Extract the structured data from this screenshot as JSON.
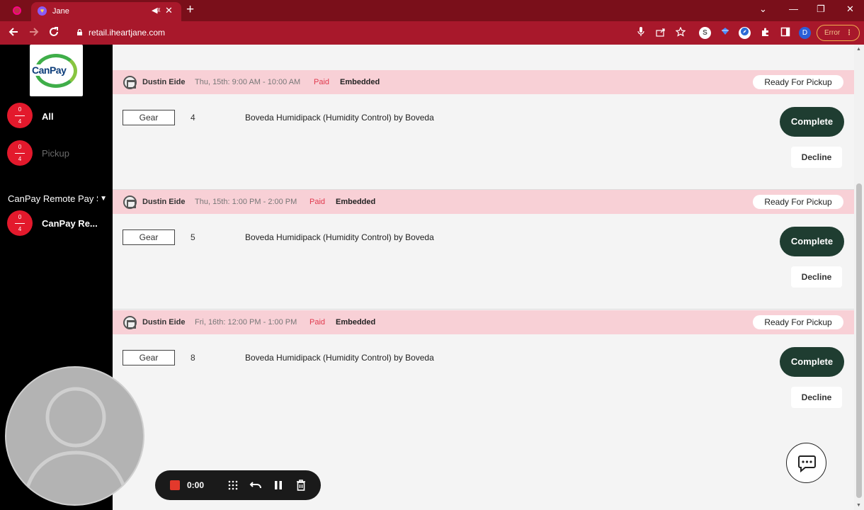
{
  "browser": {
    "tab_title": "Jane",
    "tab_close": "✕",
    "new_tab": "+",
    "url": "retail.iheartjane.com",
    "profile_initial": "D",
    "error_label": "Error",
    "error_menu": "⋮",
    "extension_s_label": "S",
    "window_minimize": "—",
    "window_maximize": "❐",
    "window_close": "✕",
    "tab_search": "⌄"
  },
  "sidebar": {
    "logo_text": "CanPay",
    "items": [
      {
        "label": "All",
        "count_top": "0",
        "count_bottom": "4"
      },
      {
        "label": "Pickup",
        "count_top": "0",
        "count_bottom": "4"
      }
    ],
    "section_label": "CanPay Remote Pay S",
    "section_items": [
      {
        "label": "CanPay Re...",
        "count_top": "0",
        "count_bottom": "4"
      }
    ]
  },
  "orders": [
    {
      "customer": "Dustin Eide",
      "slot": "Thu, 15th: 9:00 AM - 10:00 AM",
      "payment": "Paid",
      "source": "Embedded",
      "status": "Ready For Pickup",
      "category": "Gear",
      "quantity": "4",
      "product": "Boveda Humidipack (Humidity Control) by Boveda",
      "complete_label": "Complete",
      "decline_label": "Decline"
    },
    {
      "customer": "Dustin Eide",
      "slot": "Thu, 15th: 1:00 PM - 2:00 PM",
      "payment": "Paid",
      "source": "Embedded",
      "status": "Ready For Pickup",
      "category": "Gear",
      "quantity": "5",
      "product": "Boveda Humidipack (Humidity Control) by Boveda",
      "complete_label": "Complete",
      "decline_label": "Decline"
    },
    {
      "customer": "Dustin Eide",
      "slot": "Fri, 16th: 12:00 PM - 1:00 PM",
      "payment": "Paid",
      "source": "Embedded",
      "status": "Ready For Pickup",
      "category": "Gear",
      "quantity": "8",
      "product": "Boveda Humidipack (Humidity Control) by Boveda",
      "complete_label": "Complete",
      "decline_label": "Decline"
    }
  ],
  "recorder": {
    "time": "0:00"
  },
  "colors": {
    "chrome_dark": "#7a0f1a",
    "chrome": "#a8182b",
    "order_header": "#f8d0d6",
    "paid_red": "#e03a4e",
    "complete_green": "#1f3d31",
    "badge_red": "#e3192c"
  },
  "icons": {
    "chat": "chat-bubble-icon",
    "store": "store-icon",
    "rec_stop": "stop-square-icon",
    "rec_grid": "grid-dots-icon",
    "rec_undo": "undo-icon",
    "rec_pause": "pause-icon",
    "rec_delete": "trash-icon"
  }
}
